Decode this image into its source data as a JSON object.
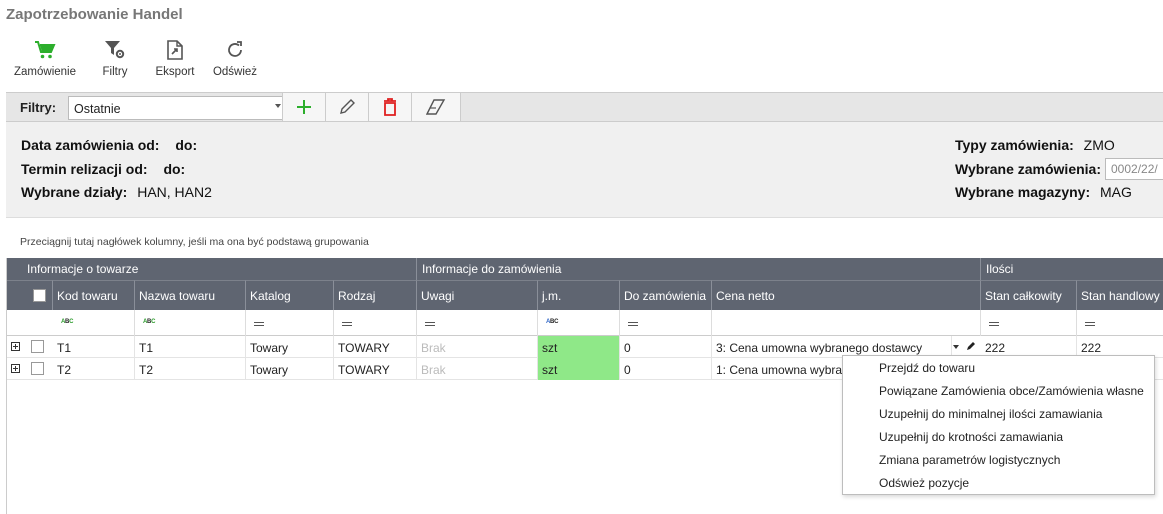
{
  "window": {
    "title": "Zapotrzebowanie Handel"
  },
  "toolbar": {
    "buttons": [
      {
        "label": "Zamówienie",
        "icon": "cart-icon"
      },
      {
        "label": "Filtry",
        "icon": "filter-settings-icon"
      },
      {
        "label": "Eksport",
        "icon": "export-icon"
      },
      {
        "label": "Odśwież",
        "icon": "refresh-icon"
      }
    ]
  },
  "filters": {
    "label": "Filtry:",
    "selected": "Ostatnie",
    "actions": [
      "add-icon",
      "edit-icon",
      "delete-icon",
      "eraser-icon"
    ]
  },
  "info": {
    "date_from_label": "Data zamówienia od:",
    "date_to_label": "do:",
    "term_from_label": "Termin relizacji od:",
    "term_to_label": "do:",
    "departments_label": "Wybrane działy:",
    "departments_value": "HAN, HAN2",
    "order_types_label": "Typy zamówienia:",
    "order_types_value": "ZMO",
    "selected_orders_label": "Wybrane zamówienia:",
    "selected_orders_value": "0002/22/",
    "warehouses_label": "Wybrane magazyny:",
    "warehouses_value": "MAG"
  },
  "grid": {
    "group_hint": "Przeciągnij tutaj nagłówek kolumny, jeśli ma ona być podstawą grupowania",
    "bands": [
      "Informacje o towarze",
      "Informacje do zamówienia",
      "Ilości"
    ],
    "columns": [
      "Kod towaru",
      "Nazwa towaru",
      "Katalog",
      "Rodzaj",
      "Uwagi",
      "j.m.",
      "Do zamówienia",
      "Cena netto",
      "Stan całkowity",
      "Stan handlowy"
    ],
    "rows": [
      {
        "kod": "T1",
        "nazwa": "T1",
        "katalog": "Towary",
        "rodzaj": "TOWARY",
        "uwagi": "Brak",
        "jm": "szt",
        "do_zam": "0",
        "cena": "3: Cena umowna wybranego dostawcy",
        "stan_calk": "222",
        "stan_handl": "222"
      },
      {
        "kod": "T2",
        "nazwa": "T2",
        "katalog": "Towary",
        "rodzaj": "TOWARY",
        "uwagi": "Brak",
        "jm": "szt",
        "do_zam": "0",
        "cena": "1: Cena umowna wybra"
      }
    ]
  },
  "context_menu": {
    "items": [
      "Przejdź do towaru",
      "Powiązane Zamówienia obce/Zamówienia własne",
      "Uzupełnij do minimalnej ilości zamawiania",
      "Uzupełnij do krotności zamawiania",
      "Zmiana parametrów logistycznych",
      "Odśwież pozycje"
    ]
  },
  "colors": {
    "header_bg": "#5f6571",
    "accent_green": "#2cae2c",
    "delete_red": "#e02020",
    "jm_cell": "#8fe888"
  }
}
